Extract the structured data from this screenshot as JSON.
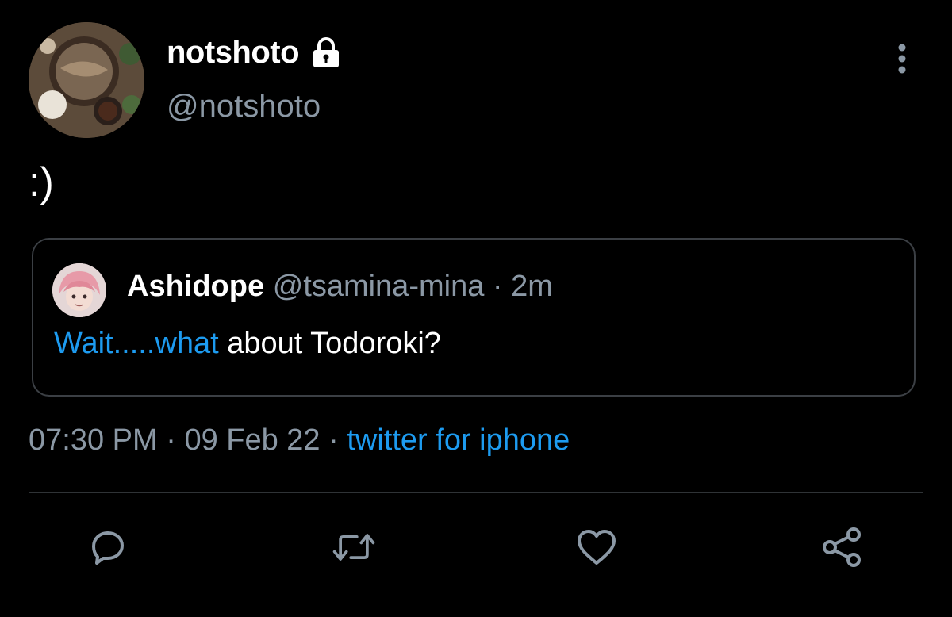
{
  "tweet": {
    "author": {
      "display_name": "notshoto",
      "handle": "@notshoto",
      "avatar_icon": "food-photo-avatar",
      "lock_icon": "lock-icon"
    },
    "text": ":)",
    "quoted": {
      "display_name": "Ashidope",
      "handle": "@tsamina-mina",
      "separator": "·",
      "time": "2m",
      "text_link": "Wait.....what",
      "text_rest": " about Todoroki?"
    },
    "timestamp": {
      "time": "07:30 PM",
      "sep1": " · ",
      "date": "09 Feb 22",
      "sep2": " · ",
      "source": "twitter for iphone"
    }
  },
  "colors": {
    "background": "#000000",
    "text": "#ffffff",
    "muted": "#8b98a5",
    "accent": "#1d9bf0",
    "border": "#3b3f44"
  },
  "actions": [
    {
      "icon": "reply-icon"
    },
    {
      "icon": "retweet-icon"
    },
    {
      "icon": "like-icon"
    },
    {
      "icon": "share-icon"
    }
  ]
}
